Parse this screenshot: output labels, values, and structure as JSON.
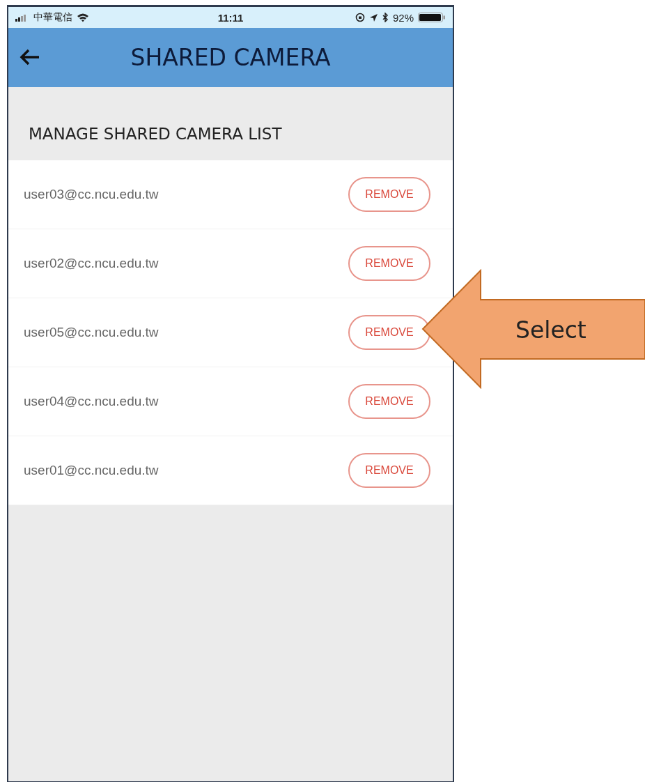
{
  "status_bar": {
    "carrier": "中華電信",
    "time": "11:11",
    "battery": "92%"
  },
  "header": {
    "title": "SHARED CAMERA"
  },
  "section_title": "MANAGE SHARED CAMERA LIST",
  "users": [
    {
      "email": "user03@cc.ncu.edu.tw",
      "button": "REMOVE"
    },
    {
      "email": "user02@cc.ncu.edu.tw",
      "button": "REMOVE"
    },
    {
      "email": "user05@cc.ncu.edu.tw",
      "button": "REMOVE"
    },
    {
      "email": "user04@cc.ncu.edu.tw",
      "button": "REMOVE"
    },
    {
      "email": "user01@cc.ncu.edu.tw",
      "button": "REMOVE"
    }
  ],
  "callout": {
    "label": "Select"
  }
}
